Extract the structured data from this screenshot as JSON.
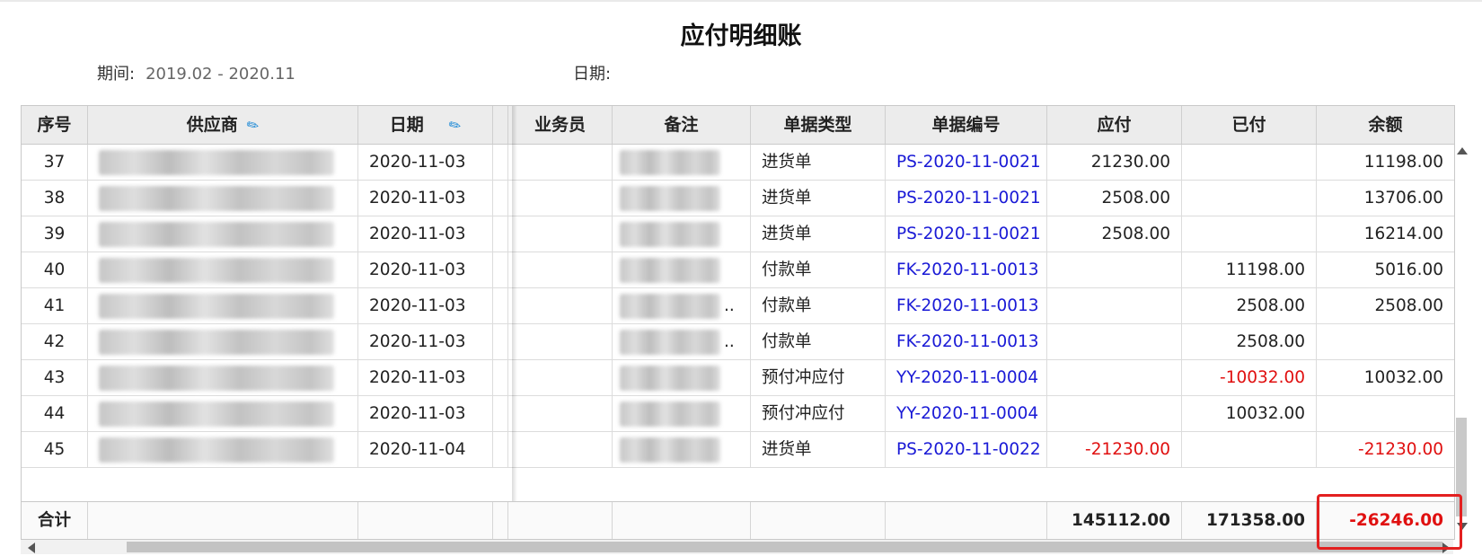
{
  "title": "应付明细账",
  "filters": {
    "period_label": "期间:",
    "period_value": "2019.02 - 2020.11",
    "date_label": "日期:",
    "date_value": ""
  },
  "columns": [
    "序号",
    "供应商",
    "日期",
    "业务员",
    "备注",
    "单据类型",
    "单据编号",
    "应付",
    "已付",
    "余额"
  ],
  "rows": [
    {
      "seq": "37",
      "supplier": "",
      "date": "2020-11-03",
      "staff": "",
      "note": "",
      "type": "进货单",
      "doc": "PS-2020-11-0021",
      "payable": "21230.00",
      "paid": "",
      "balance": "11198.00"
    },
    {
      "seq": "38",
      "supplier": "",
      "date": "2020-11-03",
      "staff": "",
      "note": "",
      "type": "进货单",
      "doc": "PS-2020-11-0021",
      "payable": "2508.00",
      "paid": "",
      "balance": "13706.00"
    },
    {
      "seq": "39",
      "supplier": "",
      "date": "2020-11-03",
      "staff": "",
      "note": "",
      "type": "进货单",
      "doc": "PS-2020-11-0021",
      "payable": "2508.00",
      "paid": "",
      "balance": "16214.00"
    },
    {
      "seq": "40",
      "supplier": "",
      "date": "2020-11-03",
      "staff": "",
      "note": "",
      "type": "付款单",
      "doc": "FK-2020-11-0013",
      "payable": "",
      "paid": "11198.00",
      "balance": "5016.00"
    },
    {
      "seq": "41",
      "supplier": "",
      "date": "2020-11-03",
      "staff": "",
      "note": "..",
      "type": "付款单",
      "doc": "FK-2020-11-0013",
      "payable": "",
      "paid": "2508.00",
      "balance": "2508.00"
    },
    {
      "seq": "42",
      "supplier": "",
      "date": "2020-11-03",
      "staff": "",
      "note": "..",
      "type": "付款单",
      "doc": "FK-2020-11-0013",
      "payable": "",
      "paid": "2508.00",
      "balance": ""
    },
    {
      "seq": "43",
      "supplier": "",
      "date": "2020-11-03",
      "staff": "",
      "note": "",
      "type": "预付冲应付",
      "doc": "YY-2020-11-0004",
      "payable": "",
      "paid": "-10032.00",
      "balance": "10032.00"
    },
    {
      "seq": "44",
      "supplier": "",
      "date": "2020-11-03",
      "staff": "",
      "note": "",
      "type": "预付冲应付",
      "doc": "YY-2020-11-0004",
      "payable": "",
      "paid": "10032.00",
      "balance": ""
    },
    {
      "seq": "45",
      "supplier": "",
      "date": "2020-11-04",
      "staff": "",
      "note": "",
      "type": "进货单",
      "doc": "PS-2020-11-0022",
      "payable": "-21230.00",
      "paid": "",
      "balance": "-21230.00"
    }
  ],
  "footer": {
    "label": "合计",
    "payable_total": "145112.00",
    "paid_total": "171358.00",
    "balance_total": "-26246.00"
  },
  "colors": {
    "link": "#1a1ad6",
    "negative": "#e01010",
    "pin_icon": "#1f8ad6",
    "highlight_box": "#e32020"
  },
  "icons": {
    "supplier_header": "pin-icon",
    "date_header": "pin-icon"
  }
}
